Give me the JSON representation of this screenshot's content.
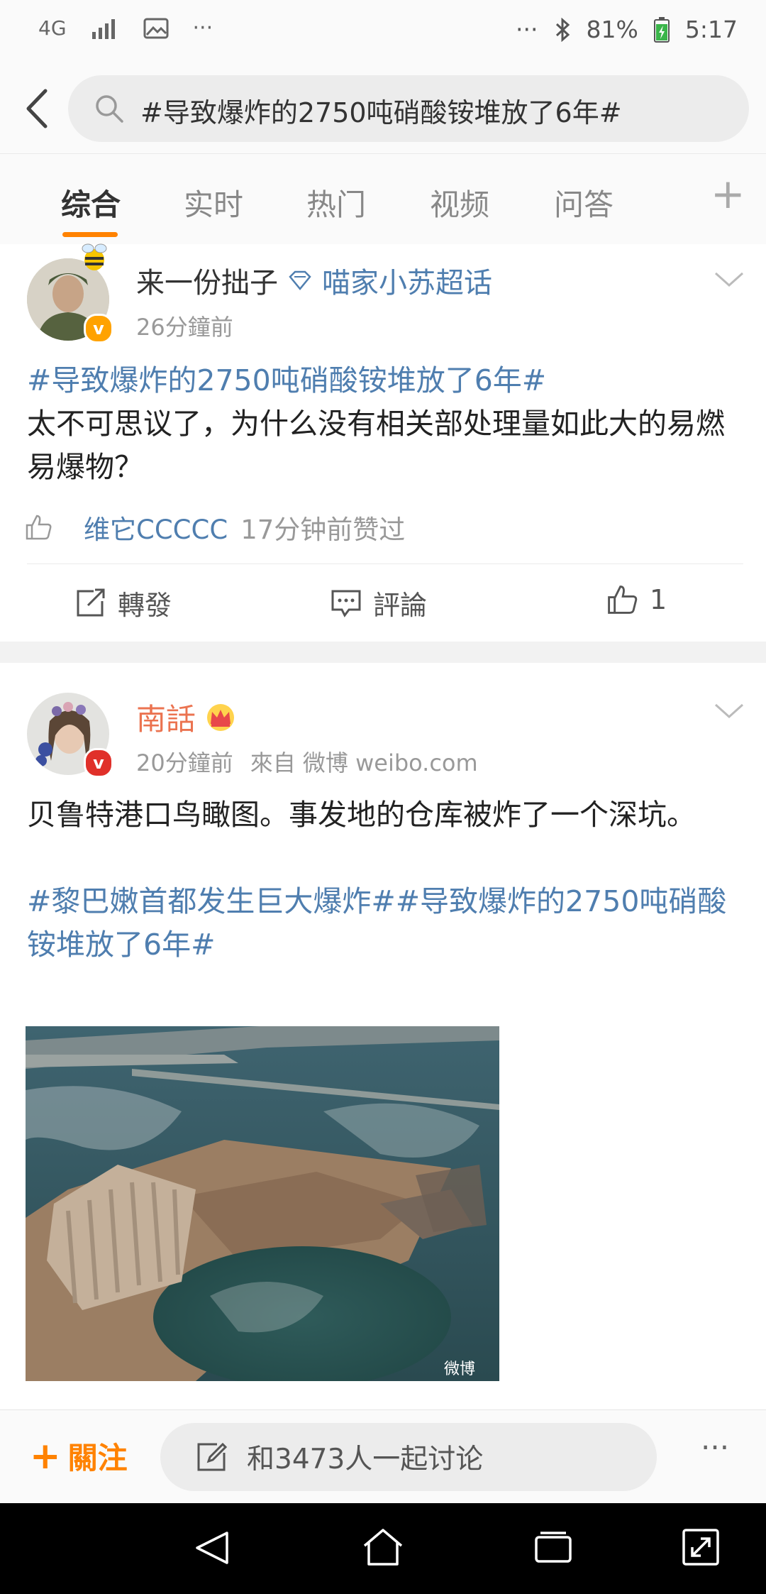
{
  "status": {
    "network": "4G",
    "battery": "81%",
    "time": "5:17",
    "more_left": "···",
    "more_right": "···"
  },
  "search": {
    "query": "#导致爆炸的2750吨硝酸铵堆放了6年#"
  },
  "tabs": [
    "综合",
    "实时",
    "热门",
    "视频",
    "问答"
  ],
  "tab_plus": "+",
  "posts": [
    {
      "author": "来一份拙子",
      "supertopic": "喵家小苏超话",
      "time": "26分鐘前",
      "topic": "#导致爆炸的2750吨硝酸铵堆放了6年#",
      "text": "太不可思议了，为什么没有相关部处理量如此大的易燃易爆物？",
      "liker_name": "维它CCCCC",
      "liker_suffix": "17分钟前赞过",
      "actions": {
        "repost": "轉發",
        "comment": "評論",
        "like_count": "1"
      }
    },
    {
      "author": "南話",
      "time": "20分鐘前",
      "source": "來自 微博 weibo.com",
      "text": "贝鲁特港口鸟瞰图。事发地的仓库被炸了一个深坑。",
      "topics": "#黎巴嫩首都发生巨大爆炸##导致爆炸的2750吨硝酸铵堆放了6年#",
      "watermark": "微博"
    }
  ],
  "bottom": {
    "follow": "關注",
    "discuss": "和3473人一起讨论",
    "more": "···"
  },
  "colors": {
    "accent": "#ff8200",
    "topic_blue": "#4f7eaf",
    "orange_name": "#eb7350",
    "verified_gold": "#ffa200",
    "verified_red": "#e0302a"
  }
}
